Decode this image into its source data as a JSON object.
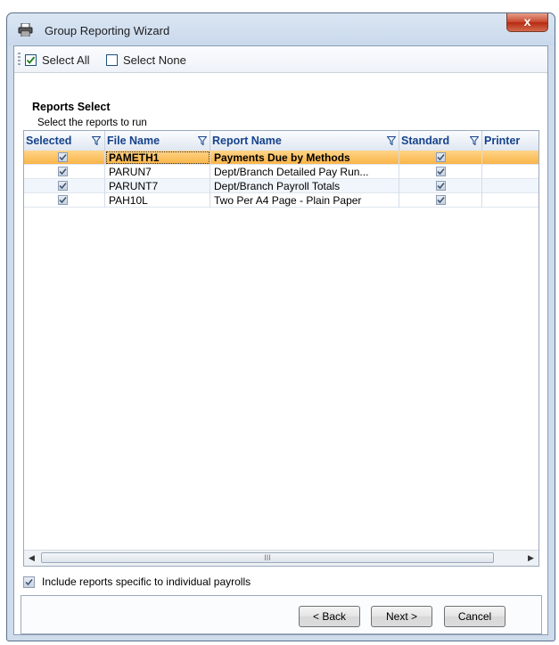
{
  "window": {
    "title": "Group Reporting Wizard",
    "close_label": "x"
  },
  "toolbar": {
    "select_all": "Select All",
    "select_none": "Select None"
  },
  "header": {
    "title": "Reports Select",
    "subtitle": "Select the reports to run"
  },
  "grid": {
    "columns": [
      "Selected",
      "File Name",
      "Report Name",
      "Standard",
      "Printer"
    ],
    "rows": [
      {
        "selected": true,
        "file": "PAMETH1",
        "report": "Payments Due by Methods",
        "standard": true,
        "printer": ""
      },
      {
        "selected": true,
        "file": "PARUN7",
        "report": "Dept/Branch Detailed Pay Run...",
        "standard": true,
        "printer": ""
      },
      {
        "selected": true,
        "file": "PARUNT7",
        "report": "Dept/Branch Payroll Totals",
        "standard": true,
        "printer": ""
      },
      {
        "selected": true,
        "file": "PAH10L",
        "report": "Two Per A4 Page - Plain Paper",
        "standard": true,
        "printer": ""
      }
    ],
    "scroll_thumb_label": "III"
  },
  "include_label": "Include reports specific to individual payrolls",
  "buttons": {
    "back": "< Back",
    "next": "Next >",
    "cancel": "Cancel"
  }
}
